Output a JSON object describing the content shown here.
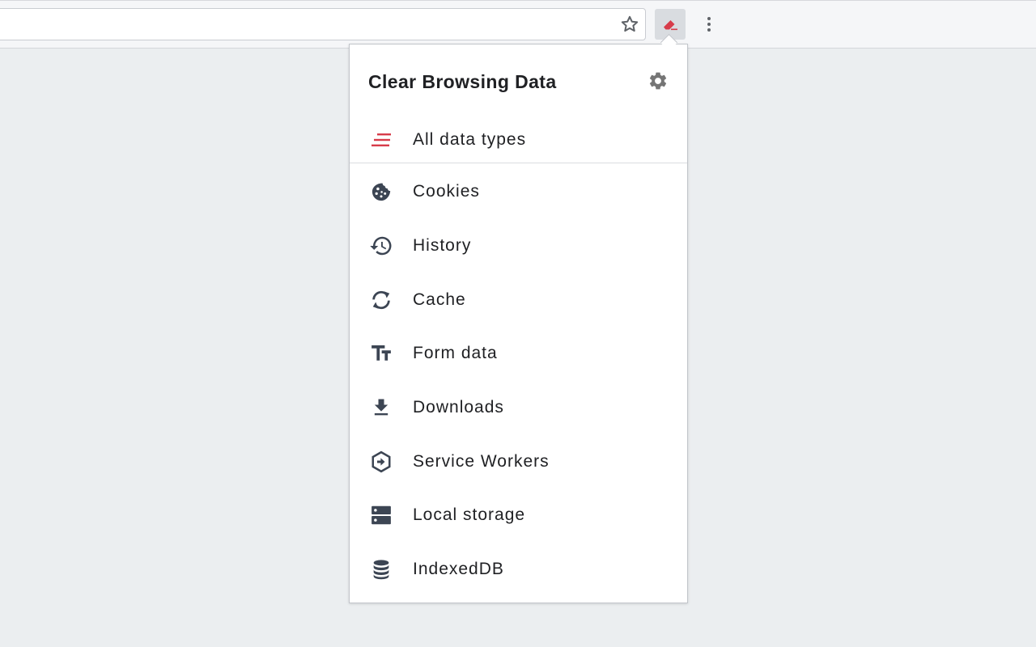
{
  "popup": {
    "title": "Clear Browsing Data",
    "all_item": {
      "label": "All data types",
      "icon": "stacked-lines-icon"
    },
    "items": [
      {
        "label": "Cookies",
        "icon": "cookie-icon"
      },
      {
        "label": "History",
        "icon": "history-icon"
      },
      {
        "label": "Cache",
        "icon": "cache-sync-icon"
      },
      {
        "label": "Form data",
        "icon": "text-fields-icon"
      },
      {
        "label": "Downloads",
        "icon": "download-icon"
      },
      {
        "label": "Service Workers",
        "icon": "service-worker-icon"
      },
      {
        "label": "Local storage",
        "icon": "storage-icon"
      },
      {
        "label": "IndexedDB",
        "icon": "database-icon"
      }
    ]
  },
  "colors": {
    "accent": "#d73c4a",
    "icon": "#3c4553",
    "text": "#202124"
  }
}
